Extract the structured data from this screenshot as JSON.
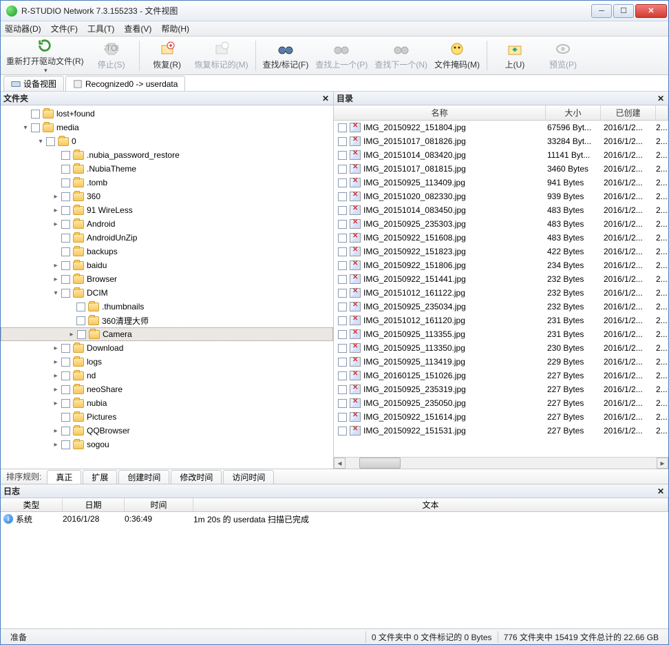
{
  "window": {
    "title": "R-STUDIO Network 7.3.155233 - 文件视图"
  },
  "menu": {
    "drive": "驱动器(D)",
    "file": "文件(F)",
    "tools": "工具(T)",
    "view": "查看(V)",
    "help": "帮助(H)"
  },
  "toolbar": {
    "reopen": "重新打开驱动文件(R)",
    "stop": "停止(S)",
    "recover": "恢复(R)",
    "recover_marked": "恢复标记的(M)",
    "find": "查找/标记(F)",
    "find_prev": "查找上一个(P)",
    "find_next": "查找下一个(N)",
    "mask": "文件掩码(M)",
    "up": "上(U)",
    "preview": "预览(P)"
  },
  "tabs": {
    "device": "设备视图",
    "recognized": "Recognized0 -> userdata"
  },
  "panels": {
    "folders": "文件夹",
    "dir": "目录"
  },
  "columns": {
    "name": "名称",
    "size": "大小",
    "created": "已创建"
  },
  "sort": {
    "label": "排序规则:",
    "real": "真正",
    "ext": "扩展",
    "ctime": "创建时间",
    "mtime": "修改时间",
    "atime": "访问时间"
  },
  "log": {
    "title": "日志",
    "cols": {
      "type": "类型",
      "date": "日期",
      "time": "时间",
      "text": "文本"
    },
    "rows": [
      {
        "type": "系统",
        "date": "2016/1/28",
        "time": "0:36:49",
        "text": "1m 20s 的 userdata 扫描已完成"
      }
    ]
  },
  "status": {
    "ready": "准备",
    "mid": "0 文件夹中 0 文件标记的 0 Bytes",
    "right": "776 文件夹中 15419 文件总计的 22.66 GB"
  },
  "tree": [
    {
      "indent": 0,
      "exp": "",
      "name": "lost+found"
    },
    {
      "indent": 0,
      "exp": "▾",
      "name": "media"
    },
    {
      "indent": 1,
      "exp": "▾",
      "name": "0"
    },
    {
      "indent": 2,
      "exp": "",
      "name": ".nubia_password_restore"
    },
    {
      "indent": 2,
      "exp": "",
      "name": ".NubiaTheme"
    },
    {
      "indent": 2,
      "exp": "",
      "name": ".tomb"
    },
    {
      "indent": 2,
      "exp": "▸",
      "name": "360",
      "special": true
    },
    {
      "indent": 2,
      "exp": "▸",
      "name": "91 WireLess"
    },
    {
      "indent": 2,
      "exp": "▸",
      "name": "Android"
    },
    {
      "indent": 2,
      "exp": "",
      "name": "AndroidUnZip"
    },
    {
      "indent": 2,
      "exp": "",
      "name": "backups"
    },
    {
      "indent": 2,
      "exp": "▸",
      "name": "baidu"
    },
    {
      "indent": 2,
      "exp": "▸",
      "name": "Browser"
    },
    {
      "indent": 2,
      "exp": "▾",
      "name": "DCIM"
    },
    {
      "indent": 3,
      "exp": "",
      "name": ".thumbnails",
      "special": true
    },
    {
      "indent": 3,
      "exp": "",
      "name": "360清理大师"
    },
    {
      "indent": 3,
      "exp": "▸",
      "name": "Camera",
      "selected": true
    },
    {
      "indent": 2,
      "exp": "▸",
      "name": "Download"
    },
    {
      "indent": 2,
      "exp": "▸",
      "name": "logs"
    },
    {
      "indent": 2,
      "exp": "▸",
      "name": "nd"
    },
    {
      "indent": 2,
      "exp": "▸",
      "name": "neoShare"
    },
    {
      "indent": 2,
      "exp": "▸",
      "name": "nubia"
    },
    {
      "indent": 2,
      "exp": "",
      "name": "Pictures"
    },
    {
      "indent": 2,
      "exp": "▸",
      "name": "QQBrowser"
    },
    {
      "indent": 2,
      "exp": "▸",
      "name": "sogou"
    }
  ],
  "files": [
    {
      "name": "IMG_20150922_151804.jpg",
      "size": "67596 Byt...",
      "created": "2016/1/2...",
      "ext": "2..."
    },
    {
      "name": "IMG_20151017_081826.jpg",
      "size": "33284 Byt...",
      "created": "2016/1/2...",
      "ext": "2..."
    },
    {
      "name": "IMG_20151014_083420.jpg",
      "size": "11141 Byt...",
      "created": "2016/1/2...",
      "ext": "2..."
    },
    {
      "name": "IMG_20151017_081815.jpg",
      "size": "3460 Bytes",
      "created": "2016/1/2...",
      "ext": "2..."
    },
    {
      "name": "IMG_20150925_113409.jpg",
      "size": "941 Bytes",
      "created": "2016/1/2...",
      "ext": "2..."
    },
    {
      "name": "IMG_20151020_082330.jpg",
      "size": "939 Bytes",
      "created": "2016/1/2...",
      "ext": "2..."
    },
    {
      "name": "IMG_20151014_083450.jpg",
      "size": "483 Bytes",
      "created": "2016/1/2...",
      "ext": "2..."
    },
    {
      "name": "IMG_20150925_235303.jpg",
      "size": "483 Bytes",
      "created": "2016/1/2...",
      "ext": "2..."
    },
    {
      "name": "IMG_20150922_151608.jpg",
      "size": "483 Bytes",
      "created": "2016/1/2...",
      "ext": "2..."
    },
    {
      "name": "IMG_20150922_151823.jpg",
      "size": "422 Bytes",
      "created": "2016/1/2...",
      "ext": "2..."
    },
    {
      "name": "IMG_20150922_151806.jpg",
      "size": "234 Bytes",
      "created": "2016/1/2...",
      "ext": "2..."
    },
    {
      "name": "IMG_20150922_151441.jpg",
      "size": "232 Bytes",
      "created": "2016/1/2...",
      "ext": "2..."
    },
    {
      "name": "IMG_20151012_161122.jpg",
      "size": "232 Bytes",
      "created": "2016/1/2...",
      "ext": "2..."
    },
    {
      "name": "IMG_20150925_235034.jpg",
      "size": "232 Bytes",
      "created": "2016/1/2...",
      "ext": "2..."
    },
    {
      "name": "IMG_20151012_161120.jpg",
      "size": "231 Bytes",
      "created": "2016/1/2...",
      "ext": "2..."
    },
    {
      "name": "IMG_20150925_113355.jpg",
      "size": "231 Bytes",
      "created": "2016/1/2...",
      "ext": "2..."
    },
    {
      "name": "IMG_20150925_113350.jpg",
      "size": "230 Bytes",
      "created": "2016/1/2...",
      "ext": "2..."
    },
    {
      "name": "IMG_20150925_113419.jpg",
      "size": "229 Bytes",
      "created": "2016/1/2...",
      "ext": "2..."
    },
    {
      "name": "IMG_20160125_151026.jpg",
      "size": "227 Bytes",
      "created": "2016/1/2...",
      "ext": "2..."
    },
    {
      "name": "IMG_20150925_235319.jpg",
      "size": "227 Bytes",
      "created": "2016/1/2...",
      "ext": "2..."
    },
    {
      "name": "IMG_20150925_235050.jpg",
      "size": "227 Bytes",
      "created": "2016/1/2...",
      "ext": "2..."
    },
    {
      "name": "IMG_20150922_151614.jpg",
      "size": "227 Bytes",
      "created": "2016/1/2...",
      "ext": "2..."
    },
    {
      "name": "IMG_20150922_151531.jpg",
      "size": "227 Bytes",
      "created": "2016/1/2...",
      "ext": "2..."
    }
  ]
}
